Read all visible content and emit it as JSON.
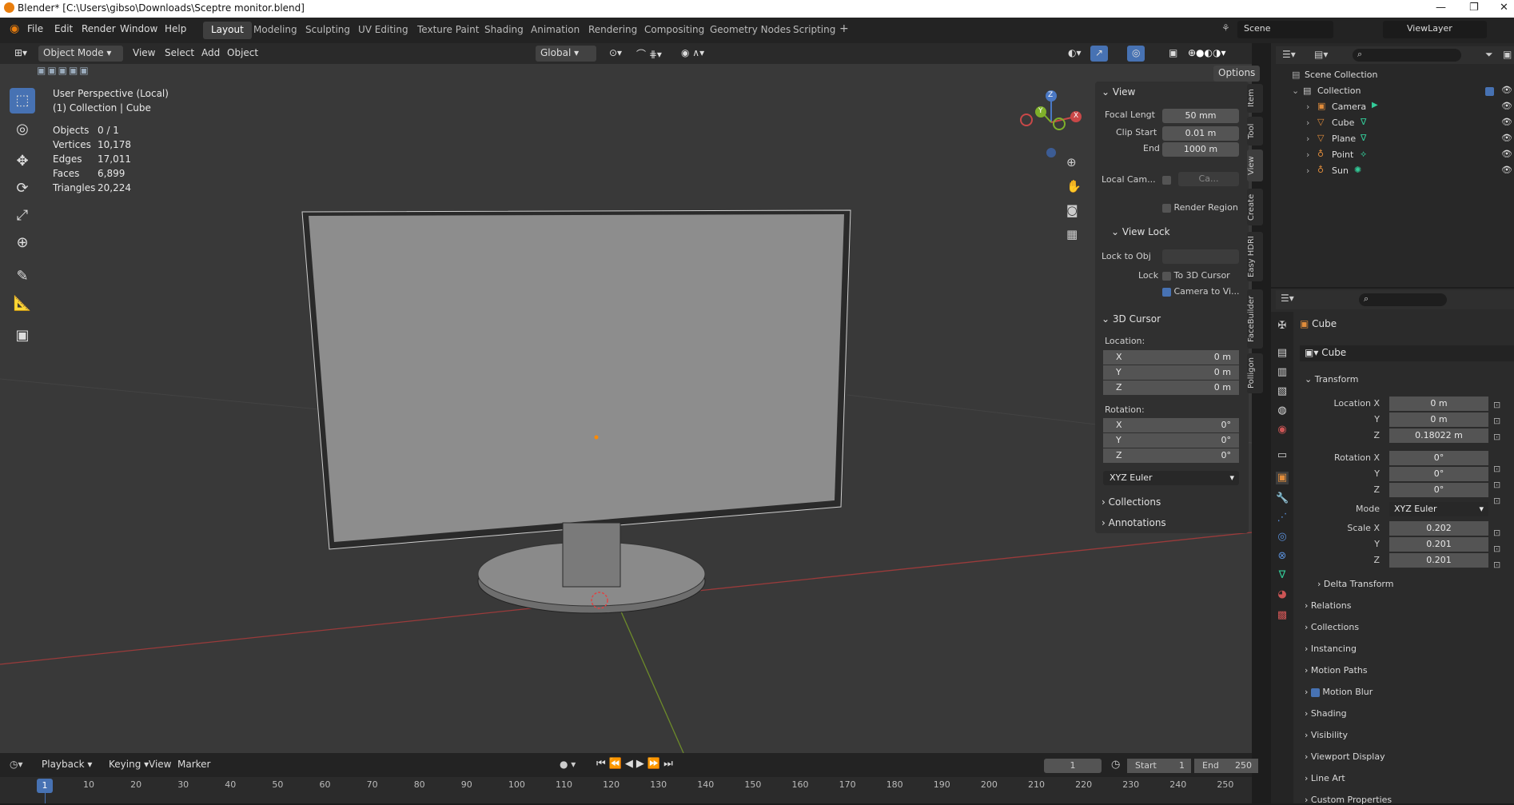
{
  "window": {
    "title": "Blender* [C:\\Users\\gibso\\Downloads\\Sceptre monitor.blend]"
  },
  "menu": [
    "File",
    "Edit",
    "Render",
    "Window",
    "Help"
  ],
  "workspaces": [
    "Layout",
    "Modeling",
    "Sculpting",
    "UV Editing",
    "Texture Paint",
    "Shading",
    "Animation",
    "Rendering",
    "Compositing",
    "Geometry Nodes",
    "Scripting"
  ],
  "active_workspace": "Layout",
  "scene": {
    "label": "Scene",
    "view_layer": "ViewLayer"
  },
  "viewport_header": {
    "mode": "Object Mode",
    "menus": [
      "View",
      "Select",
      "Add",
      "Object"
    ],
    "orientation": "Global",
    "options": "Options"
  },
  "overlay": {
    "title": "User Perspective (Local)",
    "subtitle": "(1) Collection | Cube",
    "stats": [
      {
        "label": "Objects",
        "value": "0 / 1"
      },
      {
        "label": "Vertices",
        "value": "10,178"
      },
      {
        "label": "Edges",
        "value": "17,011"
      },
      {
        "label": "Faces",
        "value": "6,899"
      },
      {
        "label": "Triangles",
        "value": "20,224"
      }
    ]
  },
  "gizmo": {
    "x": "X",
    "y": "Y",
    "z": "Z"
  },
  "npanel": {
    "view_header": "View",
    "focal_label": "Focal Lengt",
    "focal_value": "50 mm",
    "clip_start_label": "Clip Start",
    "clip_start_value": "0.01 m",
    "end_label": "End",
    "end_value": "1000 m",
    "local_cam_label": "Local Cam...",
    "local_cam_value": "Ca...",
    "render_region": "Render Region",
    "view_lock_header": "View Lock",
    "lock_to_obj_label": "Lock to Obj",
    "lock_label": "Lock",
    "to_3d_cursor": "To 3D Cursor",
    "camera_to_view": "Camera to Vi...",
    "cursor_header": "3D Cursor",
    "location_label": "Location:",
    "loc": [
      {
        "axis": "X",
        "value": "0 m"
      },
      {
        "axis": "Y",
        "value": "0 m"
      },
      {
        "axis": "Z",
        "value": "0 m"
      }
    ],
    "rotation_label": "Rotation:",
    "rot": [
      {
        "axis": "X",
        "value": "0°"
      },
      {
        "axis": "Y",
        "value": "0°"
      },
      {
        "axis": "Z",
        "value": "0°"
      }
    ],
    "rot_mode": "XYZ Euler",
    "collections": "Collections",
    "annotations": "Annotations",
    "tabs": [
      "Item",
      "Tool",
      "View",
      "Create",
      "Easy HDRI",
      "FaceBuilder",
      "Polligon"
    ]
  },
  "outliner": {
    "scene_collection": "Scene Collection",
    "collection": "Collection",
    "items": [
      "Camera",
      "Cube",
      "Plane",
      "Point",
      "Sun"
    ]
  },
  "properties": {
    "object_name": "Cube",
    "data_name": "Cube",
    "transform_header": "Transform",
    "location_label": "Location X",
    "location": [
      "0 m",
      "0 m",
      "0.18022 m"
    ],
    "rotation_label": "Rotation X",
    "rotation": [
      "0°",
      "0°",
      "0°"
    ],
    "mode_label": "Mode",
    "mode_value": "XYZ Euler",
    "scale_label": "Scale X",
    "scale": [
      "0.202",
      "0.201",
      "0.201"
    ],
    "y_label": "Y",
    "z_label": "Z",
    "sections": [
      "Delta Transform",
      "Relations",
      "Collections",
      "Instancing",
      "Motion Paths",
      "Motion Blur",
      "Shading",
      "Visibility",
      "Viewport Display",
      "Line Art",
      "Custom Properties"
    ]
  },
  "timeline": {
    "menus": [
      "Playback",
      "Keying",
      "View",
      "Marker"
    ],
    "current_frame": "1",
    "start_label": "Start",
    "start": "1",
    "end_label": "End",
    "end": "250",
    "ruler_marker": "1",
    "ticks": [
      "10",
      "20",
      "30",
      "40",
      "50",
      "60",
      "70",
      "80",
      "90",
      "100",
      "110",
      "120",
      "130",
      "140",
      "150",
      "160",
      "170",
      "180",
      "190",
      "200",
      "210",
      "220",
      "230",
      "240",
      "250"
    ]
  }
}
